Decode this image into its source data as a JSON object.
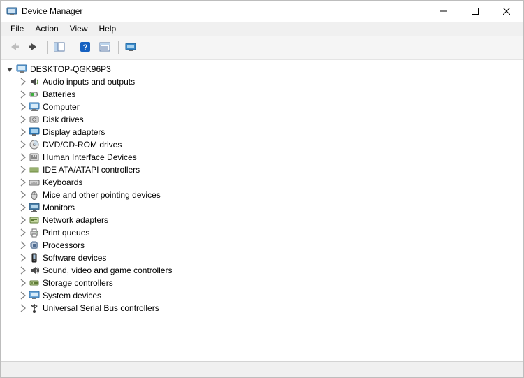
{
  "window": {
    "title": "Device Manager"
  },
  "menu": {
    "file": "File",
    "action": "Action",
    "view": "View",
    "help": "Help"
  },
  "toolbar": {
    "back": "Back",
    "forward": "Forward",
    "show_hide_tree": "Show/Hide Console Tree",
    "help": "Help",
    "properties": "Properties",
    "monitor": "Scan for hardware changes"
  },
  "tree": {
    "root": {
      "label": "DESKTOP-QGK96P3",
      "expanded": true,
      "icon": "computer"
    },
    "children": [
      {
        "label": "Audio inputs and outputs",
        "icon": "audio"
      },
      {
        "label": "Batteries",
        "icon": "battery"
      },
      {
        "label": "Computer",
        "icon": "computer"
      },
      {
        "label": "Disk drives",
        "icon": "disk"
      },
      {
        "label": "Display adapters",
        "icon": "display"
      },
      {
        "label": "DVD/CD-ROM drives",
        "icon": "dvd"
      },
      {
        "label": "Human Interface Devices",
        "icon": "hid"
      },
      {
        "label": "IDE ATA/ATAPI controllers",
        "icon": "ide"
      },
      {
        "label": "Keyboards",
        "icon": "keyboard"
      },
      {
        "label": "Mice and other pointing devices",
        "icon": "mouse"
      },
      {
        "label": "Monitors",
        "icon": "monitor"
      },
      {
        "label": "Network adapters",
        "icon": "network"
      },
      {
        "label": "Print queues",
        "icon": "printer"
      },
      {
        "label": "Processors",
        "icon": "cpu"
      },
      {
        "label": "Software devices",
        "icon": "software"
      },
      {
        "label": "Sound, video and game controllers",
        "icon": "sound"
      },
      {
        "label": "Storage controllers",
        "icon": "storage"
      },
      {
        "label": "System devices",
        "icon": "system"
      },
      {
        "label": "Universal Serial Bus controllers",
        "icon": "usb"
      }
    ]
  }
}
